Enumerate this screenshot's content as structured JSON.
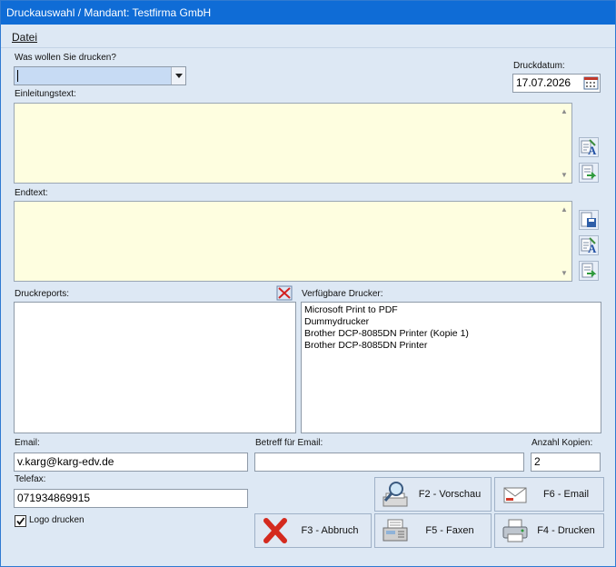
{
  "window": {
    "title": "Druckauswahl / Mandant: Testfirma GmbH"
  },
  "menu": {
    "datei": "Datei"
  },
  "form": {
    "was_label": "Was wollen Sie drucken?",
    "was_value": "",
    "datum_label": "Druckdatum:",
    "datum_value": "17.07.2026",
    "einleitung_label": "Einleitungstext:",
    "endtext_label": "Endtext:",
    "reports_label": "Druckreports:",
    "drucker_label": "Verfügbare Drucker:",
    "drucker": [
      "Microsoft Print to PDF",
      "Dummydrucker",
      "Brother DCP-8085DN Printer (Kopie 1)",
      "Brother DCP-8085DN Printer"
    ],
    "email_label": "Email:",
    "email_value": "v.karg@karg-edv.de",
    "betreff_label": "Betreff für Email:",
    "betreff_value": "",
    "kopien_label": "Anzahl Kopien:",
    "kopien_value": "2",
    "telefax_label": "Telefax:",
    "telefax_value": "071934869915",
    "logo_label": "Logo drucken",
    "logo_checked": true
  },
  "buttons": {
    "vorschau": "F2 - Vorschau",
    "email": "F6 - Email",
    "abbruch": "F3 - Abbruch",
    "faxen": "F5 - Faxen",
    "drucken": "F4 - Drucken"
  },
  "colors": {
    "titlebar": "#0f6cd6",
    "window_bg": "#dde8f4",
    "textarea_bg": "#fefee0",
    "combo_bg": "#c7dbf4"
  },
  "icons": {
    "calendar": "calendar-icon",
    "edit_font": "edit-font-icon",
    "insert": "insert-text-icon",
    "save": "save-text-icon",
    "clear": "clear-reports-icon",
    "preview": "magnifier-icon",
    "email": "email-envelope-icon",
    "cancel": "red-x-icon",
    "fax": "fax-icon",
    "print": "printer-icon"
  }
}
